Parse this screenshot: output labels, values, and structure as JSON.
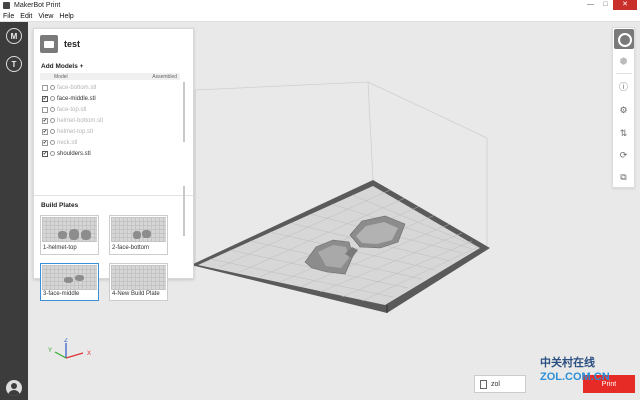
{
  "window": {
    "title": "MakerBot Print",
    "controls": {
      "minimize": "—",
      "maximize": "□",
      "close": "✕"
    }
  },
  "menubar": {
    "items": [
      "File",
      "Edit",
      "View",
      "Help"
    ]
  },
  "leftbar": {
    "items": [
      {
        "icon": "makerbot-logo-icon",
        "glyph": "M"
      },
      {
        "icon": "thingiverse-icon",
        "glyph": "T"
      }
    ],
    "account_icon": "user-account-icon"
  },
  "panel": {
    "project_name": "test",
    "add_models_label": "Add Models +",
    "columns": {
      "model": "Model",
      "assembled": "Assembled"
    },
    "models": [
      {
        "name": "face-bottom.stl",
        "checked": false
      },
      {
        "name": "face-middle.stl",
        "checked": true
      },
      {
        "name": "face-top.stl",
        "checked": false
      },
      {
        "name": "helmet-bottom.stl",
        "checked": true
      },
      {
        "name": "helmet-top.stl",
        "checked": true
      },
      {
        "name": "neck.stl",
        "checked": true
      },
      {
        "name": "shoulders.stl",
        "checked": true
      }
    ],
    "build_plates_label": "Build Plates",
    "build_plates": [
      {
        "label": "1-helmet-top",
        "selected": false
      },
      {
        "label": "2-face-bottom",
        "selected": false
      },
      {
        "label": "3-face-middle",
        "selected": true
      },
      {
        "label": "4-New Build Plate",
        "selected": false
      }
    ]
  },
  "rightbar": {
    "icons": [
      "view-icon",
      "info-icon",
      "settings-icon",
      "arrange-icon",
      "rotate-icon",
      "scale-icon"
    ]
  },
  "bottom": {
    "file_badge": "zol",
    "print_label": "Print",
    "watermark": {
      "line1": "中关村在线",
      "line2": "ZOL.COM.CN"
    }
  },
  "axes": {
    "x": "X",
    "y": "Y",
    "z": "Z"
  },
  "colors": {
    "sidebar_bg": "#3c3c3c",
    "viewport_bg": "#e9e9e9",
    "print_button": "#e62a25",
    "selection_blue": "#3b8fd9"
  }
}
